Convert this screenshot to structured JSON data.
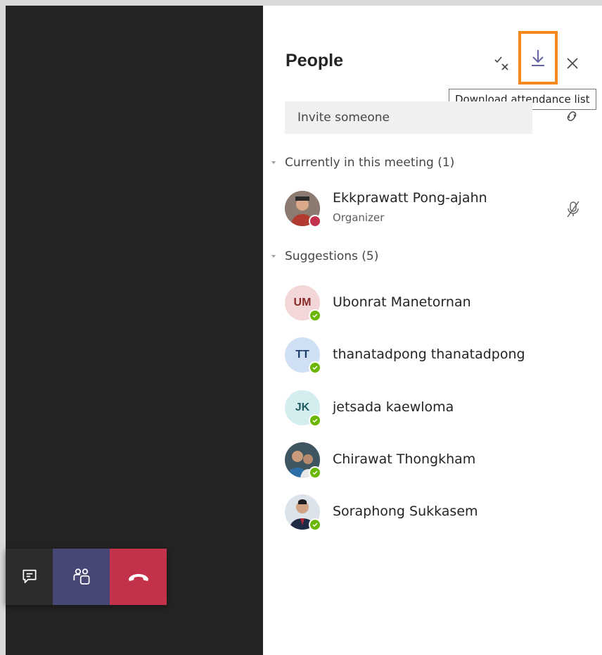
{
  "panel": {
    "title": "People",
    "tooltip": "Download attendance list",
    "invite_placeholder": "Invite someone"
  },
  "sections": {
    "current": "Currently in this meeting (1)",
    "suggestions": "Suggestions (5)"
  },
  "organizer": {
    "name": "Ekkprawatt Pong-ajahn",
    "role": "Organizer",
    "status": "busy"
  },
  "suggestions": [
    {
      "initials": "UM",
      "name": "Ubonrat Manetornan",
      "avatar_bg": "#f3d6d8",
      "avatar_fg": "#8a2a2b"
    },
    {
      "initials": "TT",
      "name": "thanatadpong thanatadpong",
      "avatar_bg": "#cfdff4",
      "avatar_fg": "#1f3f6e"
    },
    {
      "initials": "JK",
      "name": "jetsada kaewloma",
      "avatar_bg": "#d4eef0",
      "avatar_fg": "#1f5c63"
    },
    {
      "initials": "",
      "name": "Chirawat Thongkham",
      "avatar_bg": "#4a5a63",
      "avatar_fg": "#ffffff"
    },
    {
      "initials": "",
      "name": "Soraphong Sukkasem",
      "avatar_bg": "#5a6e8a",
      "avatar_fg": "#ffffff"
    }
  ],
  "colors": {
    "accent": "#6264a7",
    "highlight": "#f5881f",
    "available": "#6bb700",
    "busy": "#c4314b",
    "leave": "#c4314b",
    "people_active": "#464775"
  }
}
